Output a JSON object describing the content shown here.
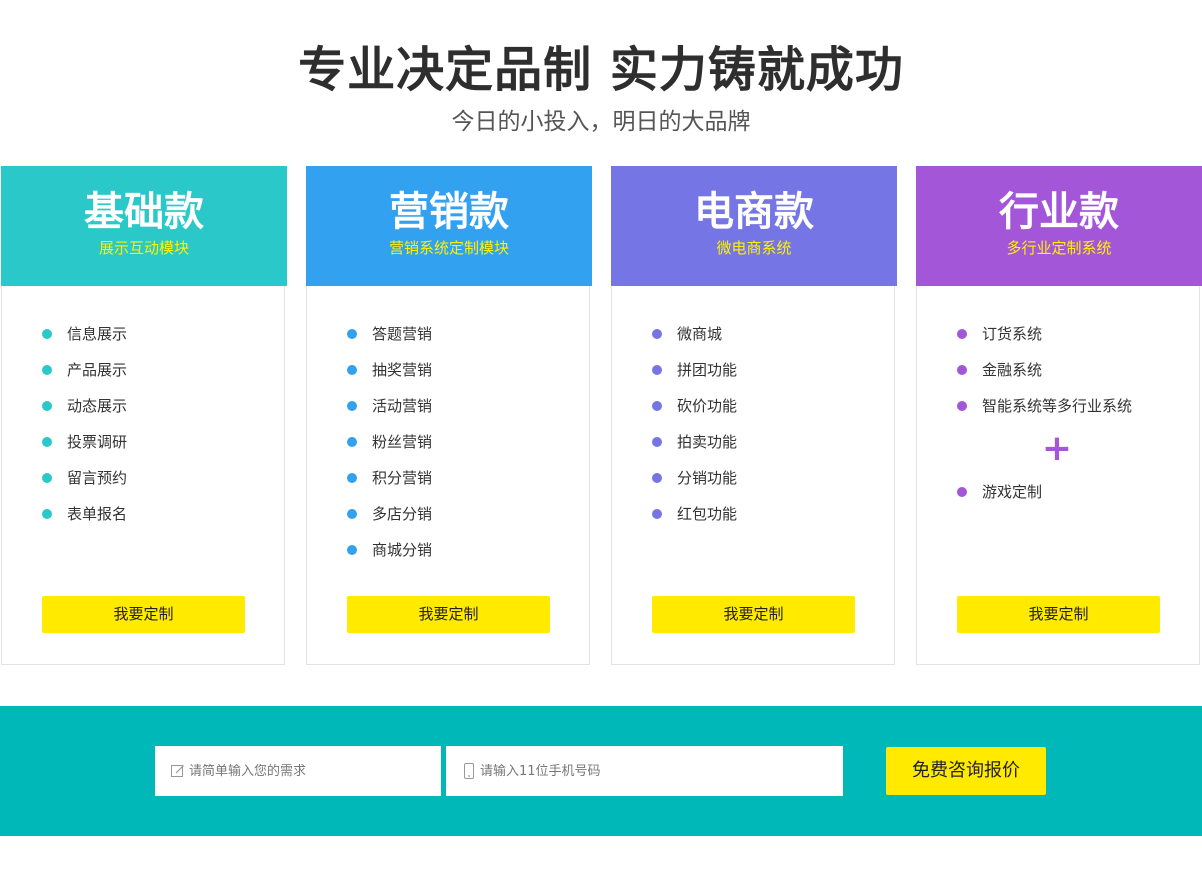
{
  "header": {
    "title": "专业决定品制 实力铸就成功",
    "subtitle": "今日的小投入，明日的大品牌"
  },
  "plans": [
    {
      "name": "基础款",
      "desc": "展示互动模块",
      "color": "#2ac8c8",
      "features": [
        "信息展示",
        "产品展示",
        "动态展示",
        "投票调研",
        "留言预约",
        "表单报名"
      ],
      "button": "我要定制"
    },
    {
      "name": "营销款",
      "desc": "营销系统定制模块",
      "color": "#31a1f0",
      "features": [
        "答题营销",
        "抽奖营销",
        "活动营销",
        "粉丝营销",
        "积分营销",
        "多店分销",
        "商城分销"
      ],
      "button": "我要定制"
    },
    {
      "name": "电商款",
      "desc": "微电商系统",
      "color": "#7575e5",
      "features": [
        "微商城",
        "拼团功能",
        "砍价功能",
        "拍卖功能",
        "分销功能",
        "红包功能"
      ],
      "button": "我要定制"
    },
    {
      "name": "行业款",
      "desc": "多行业定制系统",
      "color": "#a356d8",
      "features": [
        "订货系统",
        "金融系统",
        "智能系统等多行业系统"
      ],
      "plus": "+",
      "extra_features": [
        "游戏定制"
      ],
      "button": "我要定制"
    }
  ],
  "banner": {
    "bg_color": "#00b8b8",
    "need_input": {
      "placeholder": "请简单输入您的需求",
      "value": "",
      "icon": "edit-icon"
    },
    "phone_input": {
      "placeholder": "请输入11位手机号码",
      "value": "",
      "icon": "mobile-phone-icon"
    },
    "quote_button": "免费咨询报价"
  }
}
